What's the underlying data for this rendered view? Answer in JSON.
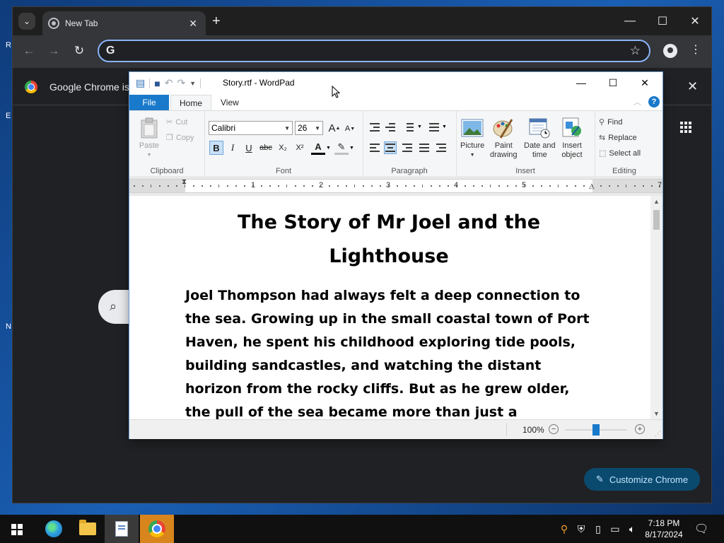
{
  "chrome": {
    "tab_title": "New Tab",
    "new_tab_symbol": "+",
    "omnibox": {
      "icon": "G",
      "value": ""
    },
    "infobar_message": "Google Chrome isn't",
    "customize_label": "Customize Chrome"
  },
  "wordpad": {
    "window_title": "Story.rtf - WordPad",
    "menu_tabs": {
      "file": "File",
      "home": "Home",
      "view": "View"
    },
    "clipboard": {
      "paste": "Paste",
      "cut": "Cut",
      "copy": "Copy",
      "label": "Clipboard"
    },
    "font": {
      "family": "Calibri",
      "size": "26",
      "label": "Font",
      "bold": "B",
      "italic": "I",
      "underline": "U",
      "strike": "abc",
      "subscript": "X₂",
      "superscript": "X²",
      "grow": "A",
      "shrink": "A"
    },
    "paragraph": {
      "label": "Paragraph"
    },
    "insert": {
      "picture": "Picture",
      "paint_drawing_1": "Paint",
      "paint_drawing_2": "drawing",
      "date_time_1": "Date and",
      "date_time_2": "time",
      "insert_object_1": "Insert",
      "insert_object_2": "object",
      "label": "Insert"
    },
    "editing": {
      "find": "Find",
      "replace": "Replace",
      "select_all": "Select all",
      "label": "Editing"
    },
    "ruler_numbers": [
      "1",
      "2",
      "3",
      "4",
      "5",
      "7"
    ],
    "document": {
      "title_line1": "The Story of Mr Joel and the",
      "title_line2": "Lighthouse",
      "body": "Joel Thompson had always felt a deep connection to the sea. Growing up in the small coastal town of Port Haven, he spent his childhood exploring tide pools, building sandcastles, and watching the distant horizon from the rocky cliffs. But as he grew older, the pull of the sea became more than just a childhood fascination—it"
    },
    "status": {
      "zoom": "100%",
      "zoom_level": 1.0
    }
  },
  "taskbar": {
    "time": "7:18 PM",
    "date": "8/17/2024"
  },
  "colors": {
    "accent_blue": "#1979ca",
    "chrome_focus": "#8ab4f8",
    "taskbar_active": "#d8851e"
  }
}
